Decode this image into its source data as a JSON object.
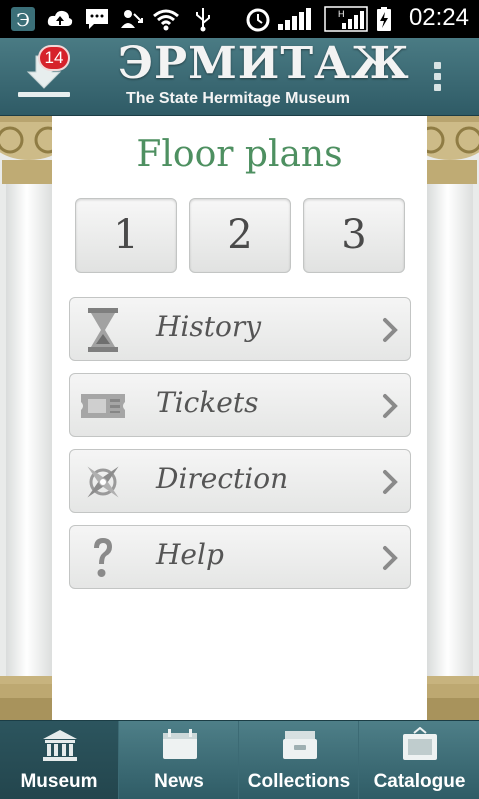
{
  "statusbar": {
    "time": "02:24",
    "icons": [
      "app-icon",
      "cloud-upload-icon",
      "chat-icon",
      "missed-call-icon",
      "wifi-icon",
      "usb-icon",
      "alarm-icon",
      "signal-icon",
      "hd-signal-icon",
      "battery-charging-icon"
    ]
  },
  "header": {
    "download_badge": "14",
    "logo_title": "ЭРМИТАЖ",
    "logo_subtitle": "The State Hermitage Museum"
  },
  "page": {
    "title": "Floor plans",
    "floors": [
      "1",
      "2",
      "3"
    ],
    "items": [
      {
        "label": "History",
        "icon": "hourglass-icon"
      },
      {
        "label": "Tickets",
        "icon": "ticket-icon"
      },
      {
        "label": "Direction",
        "icon": "compass-icon"
      },
      {
        "label": "Help",
        "icon": "question-icon"
      }
    ]
  },
  "bottom_nav": {
    "items": [
      {
        "label": "Museum",
        "icon": "museum-icon",
        "active": true
      },
      {
        "label": "News",
        "icon": "news-icon",
        "active": false
      },
      {
        "label": "Collections",
        "icon": "collections-icon",
        "active": false
      },
      {
        "label": "Catalogue",
        "icon": "catalogue-icon",
        "active": false
      }
    ]
  },
  "colors": {
    "header_teal": "#3a6a74",
    "title_green": "#4e9061",
    "badge_red": "#d6222b"
  }
}
